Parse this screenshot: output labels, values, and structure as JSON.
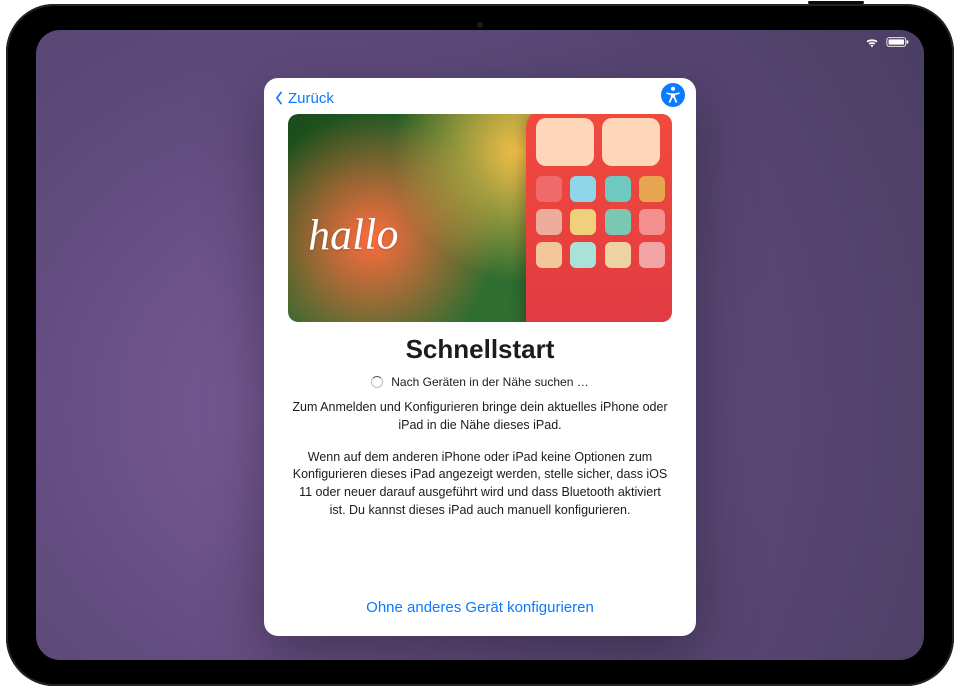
{
  "back_label": "Zurück",
  "title": "Schnellstart",
  "searching_text": "Nach Geräten in der Nähe suchen …",
  "paragraph1": "Zum Anmelden und Konfigurieren bringe dein aktuelles iPhone oder iPad in die Nähe dieses iPad.",
  "paragraph2": "Wenn auf dem anderen iPhone oder iPad keine Optionen zum Konfigurieren dieses iPad angezeigt werden, stelle sicher, dass iOS 11 oder neuer darauf ausgeführt wird und dass Bluetooth aktiviert ist. Du kannst dieses iPad auch manuell konfigurieren.",
  "alt_setup_label": "Ohne anderes Gerät konfigurieren",
  "hero_word": "hallo",
  "colors": {
    "link": "#0a7aff"
  }
}
